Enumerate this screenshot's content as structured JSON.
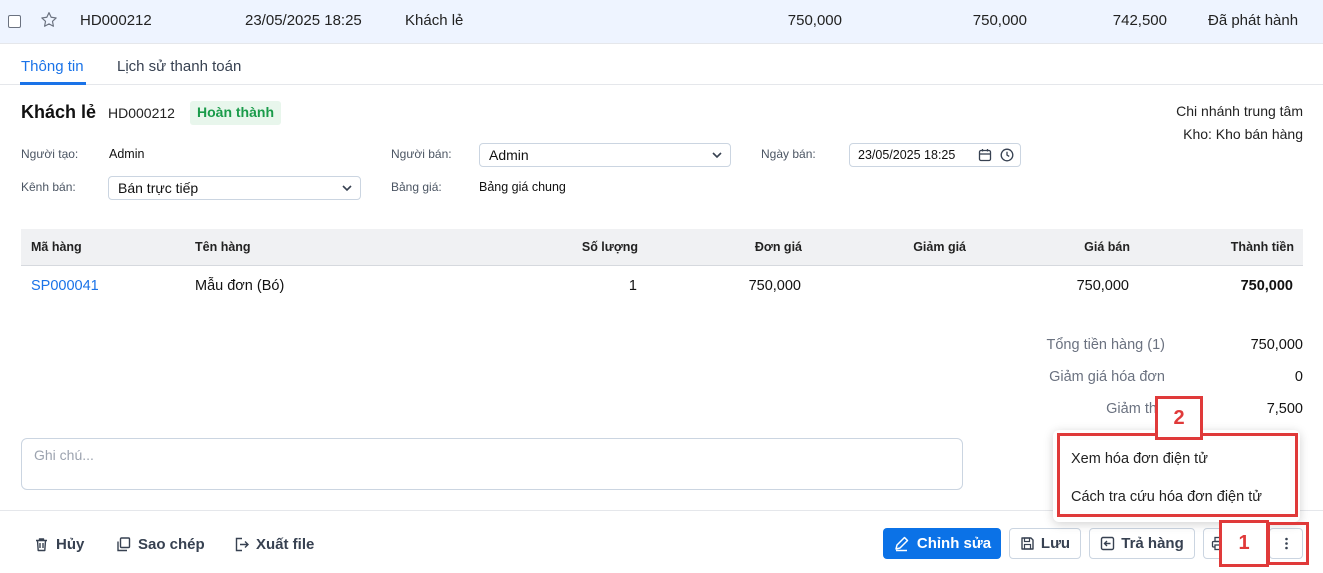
{
  "invoice_row": {
    "code": "HD000212",
    "datetime": "23/05/2025 18:25",
    "customer": "Khách lẻ",
    "amount1": "750,000",
    "amount2": "750,000",
    "amount3": "742,500",
    "status": "Đã phát hành"
  },
  "tabs": [
    "Thông tin",
    "Lịch sử thanh toán"
  ],
  "header": {
    "customer": "Khách lẻ",
    "code": "HD000212",
    "status_badge": "Hoàn thành",
    "branch": "Chi nhánh trung tâm",
    "store": "Kho: Kho bán hàng"
  },
  "form": {
    "creator_label": "Người tạo:",
    "creator_value": "Admin",
    "seller_label": "Người bán:",
    "seller_value": "Admin",
    "date_label": "Ngày bán:",
    "date_value": "23/05/2025 18:25",
    "channel_label": "Kênh bán:",
    "channel_value": "Bán trực tiếp",
    "pricelist_label": "Bảng giá:",
    "pricelist_value": "Bảng giá chung"
  },
  "table": {
    "headers": [
      "Mã hàng",
      "Tên hàng",
      "Số lượng",
      "Đơn giá",
      "Giảm giá",
      "Giá bán",
      "Thành tiền"
    ],
    "rows": [
      [
        "SP000041",
        "Mẫu đơn (Bó)",
        "1",
        "750,000",
        "",
        "750,000",
        "750,000"
      ]
    ]
  },
  "summary": {
    "total_label": "Tổng tiền hàng (1)",
    "total_value": "750,000",
    "discount_label": "Giảm giá hóa đơn",
    "discount_value": "0",
    "tax_label": "Giảm thu",
    "tax_value": "7,500"
  },
  "note": {
    "placeholder": "Ghi chú..."
  },
  "footer": {
    "cancel": "Hủy",
    "copy": "Sao chép",
    "export": "Xuất file",
    "edit": "Chỉnh sửa",
    "save": "Lưu",
    "return": "Trả hàng"
  },
  "menu": {
    "items": [
      "Xem hóa đơn điện tử",
      "Cách tra cứu hóa đơn điện tử"
    ]
  },
  "annotations": {
    "marker1": "1",
    "marker2": "2"
  },
  "colors": {
    "accent": "#1a73e8",
    "primary_button": "#0b72e7",
    "badge_green": "#1a9b4a",
    "annotation_red": "#e03a3a"
  },
  "icons": [
    "star-icon",
    "chevron-down-icon",
    "calendar-icon",
    "clock-icon",
    "trash-icon",
    "copy-icon",
    "export-icon",
    "pencil-icon",
    "save-icon",
    "return-icon",
    "print-icon",
    "more-vertical-icon"
  ]
}
